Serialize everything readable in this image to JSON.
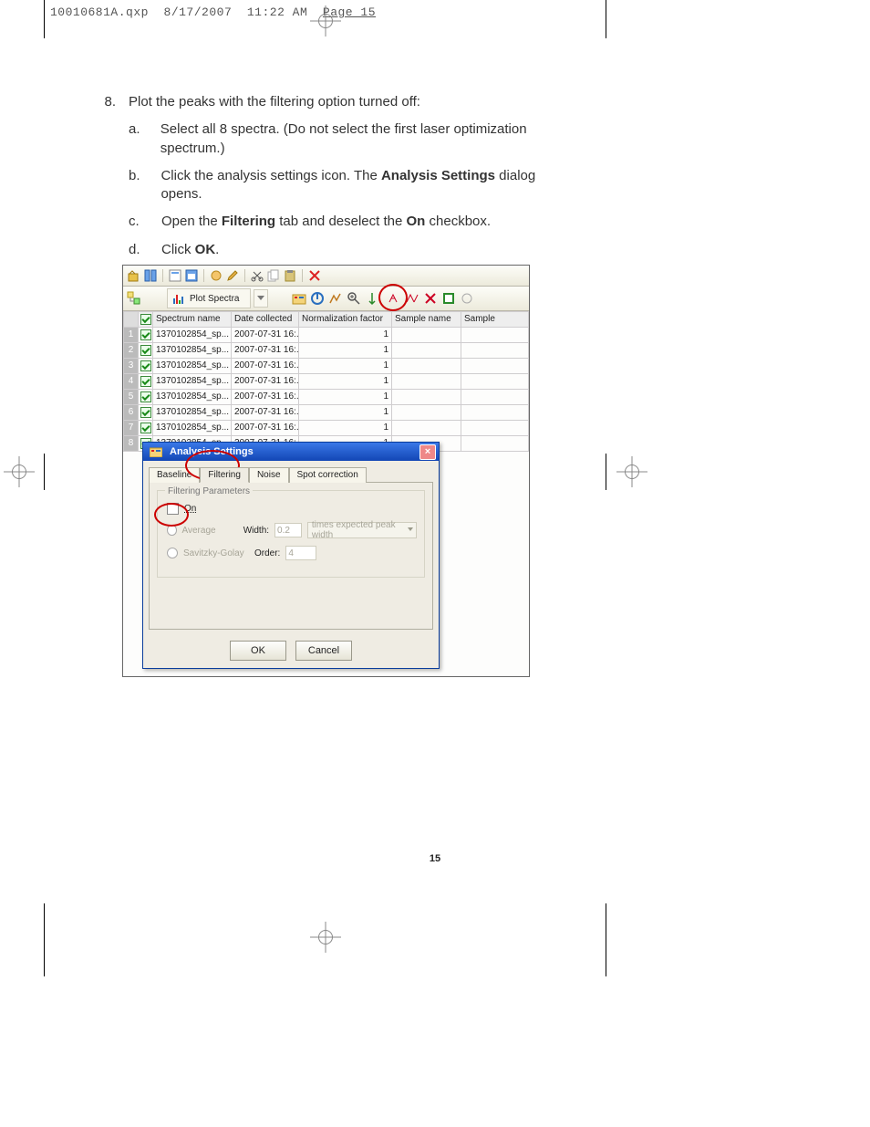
{
  "slug": {
    "file": "10010681A.qxp",
    "date": "8/17/2007",
    "time": "11:22 AM",
    "page": "Page 15"
  },
  "step": {
    "num": "8.",
    "text": "Plot the peaks with the filtering option turned off:"
  },
  "sub": {
    "a": {
      "lt": "a.",
      "p1": "Select all 8 spectra. (Do not select the first laser optimization spectrum.)"
    },
    "b": {
      "lt": "b.",
      "p1": "Click the analysis settings icon. The ",
      "b": "Analysis Settings",
      "p2": " dialog opens."
    },
    "c": {
      "lt": "c.",
      "p1": "Open the ",
      "b1": "Filtering",
      "p2": " tab and deselect the ",
      "b2": "On",
      "p3": " checkbox."
    },
    "d": {
      "lt": "d.",
      "p1": "Click ",
      "b": "OK",
      "p2": "."
    }
  },
  "toolbar2": {
    "plot_label": "Plot Spectra"
  },
  "table": {
    "headers": {
      "name": "Spectrum name",
      "date": "Date collected",
      "norm": "Normalization factor",
      "sample_name": "Sample name",
      "sample": "Sample"
    },
    "rows": [
      {
        "n": "1",
        "name": "1370102854_sp...",
        "date": "2007-07-31 16:...",
        "norm": "1"
      },
      {
        "n": "2",
        "name": "1370102854_sp...",
        "date": "2007-07-31 16:...",
        "norm": "1"
      },
      {
        "n": "3",
        "name": "1370102854_sp...",
        "date": "2007-07-31 16:...",
        "norm": "1"
      },
      {
        "n": "4",
        "name": "1370102854_sp...",
        "date": "2007-07-31 16:...",
        "norm": "1"
      },
      {
        "n": "5",
        "name": "1370102854_sp...",
        "date": "2007-07-31 16:...",
        "norm": "1"
      },
      {
        "n": "6",
        "name": "1370102854_sp...",
        "date": "2007-07-31 16:...",
        "norm": "1"
      },
      {
        "n": "7",
        "name": "1370102854_sp...",
        "date": "2007-07-31 16:...",
        "norm": "1"
      },
      {
        "n": "8",
        "name": "1370102854_sp...",
        "date": "2007-07-31 16:...",
        "norm": "1"
      }
    ]
  },
  "dialog": {
    "title": "Analysis Settings",
    "tabs": {
      "baseline": "Baseline",
      "filtering": "Filtering",
      "noise": "Noise",
      "spot": "Spot correction"
    },
    "legend": "Filtering Parameters",
    "on_label": "On",
    "avg_label": "Average",
    "width_label": "Width:",
    "width_val": "0.2",
    "width_unit": "times expected peak width",
    "sg_label": "Savitzky-Golay",
    "order_label": "Order:",
    "order_val": "4",
    "ok": "OK",
    "cancel": "Cancel"
  },
  "page_number": "15"
}
